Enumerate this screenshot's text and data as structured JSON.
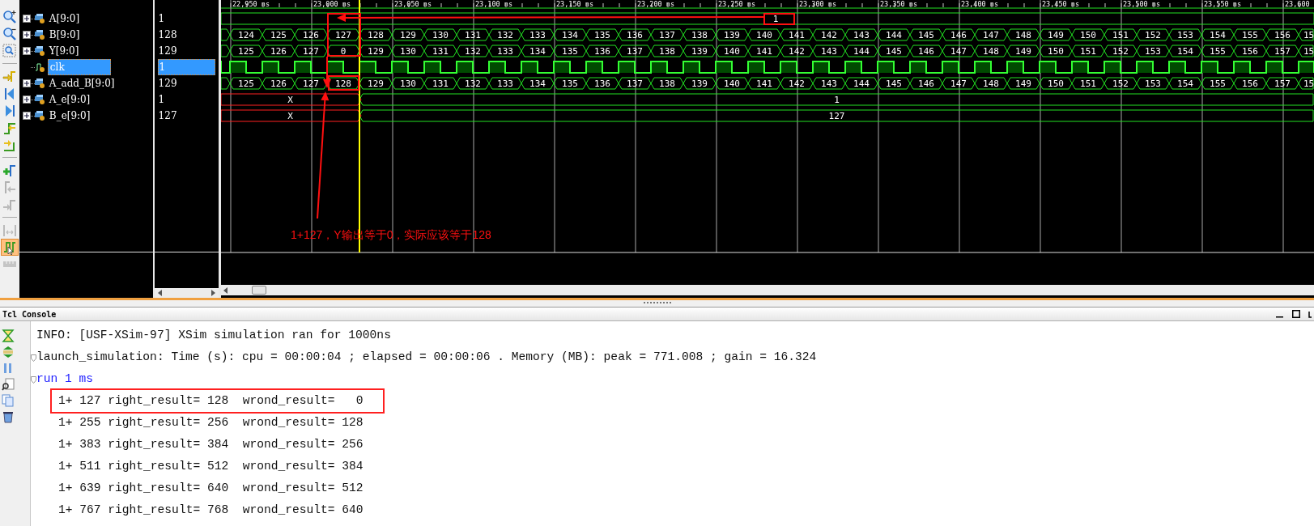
{
  "toolbar_groups": [
    {
      "tools": [
        {
          "kind": "zoom-in",
          "selected": false,
          "disabled": false
        },
        {
          "kind": "zoom-out",
          "selected": false,
          "disabled": false
        },
        {
          "kind": "zoom-fit",
          "selected": false,
          "disabled": false
        }
      ]
    },
    {
      "tools": [
        {
          "kind": "goto-cursor",
          "selected": false,
          "disabled": false
        },
        {
          "kind": "go-start",
          "selected": false,
          "disabled": false
        },
        {
          "kind": "go-end",
          "selected": false,
          "disabled": false
        },
        {
          "kind": "prev-transition",
          "selected": false,
          "disabled": false
        },
        {
          "kind": "next-transition",
          "selected": false,
          "disabled": false
        }
      ]
    },
    {
      "tools": [
        {
          "kind": "add-marker",
          "selected": false,
          "disabled": false
        },
        {
          "kind": "prev-marker",
          "selected": false,
          "disabled": true
        },
        {
          "kind": "next-marker",
          "selected": false,
          "disabled": true
        }
      ]
    },
    {
      "tools": [
        {
          "kind": "swap-cursors",
          "selected": false,
          "disabled": true
        },
        {
          "kind": "snap",
          "selected": true,
          "disabled": false
        },
        {
          "kind": "ruler",
          "selected": false,
          "disabled": true
        }
      ]
    }
  ],
  "time_ruler": {
    "labels": [
      "22,950 ns",
      "23,000 ns",
      "23,050 ns",
      "23,100 ns",
      "23,150 ns",
      "23,200 ns",
      "23,250 ns",
      "23,300 ns",
      "23,350 ns",
      "23,400 ns",
      "23,450 ns",
      "23,500 ns",
      "23,550 ns",
      "23,600"
    ]
  },
  "signals": [
    {
      "name": "A[9:0]",
      "value": "1",
      "expandable": true,
      "selected": false,
      "wave": {
        "kind": "const",
        "label": "1"
      }
    },
    {
      "name": "B[9:0]",
      "value": "128",
      "expandable": true,
      "selected": false,
      "wave": {
        "kind": "bus",
        "values": [
          "124",
          "125",
          "126",
          "127",
          "128",
          "129",
          "130",
          "131",
          "132",
          "133",
          "134",
          "135",
          "136",
          "137",
          "138",
          "139",
          "140",
          "141",
          "142",
          "143",
          "144",
          "145",
          "146",
          "147",
          "148",
          "149",
          "150",
          "151",
          "152",
          "153",
          "154",
          "155",
          "156",
          "15"
        ]
      }
    },
    {
      "name": "Y[9:0]",
      "value": "129",
      "expandable": true,
      "selected": false,
      "wave": {
        "kind": "bus",
        "values": [
          "125",
          "126",
          "127",
          "0",
          "129",
          "130",
          "131",
          "132",
          "133",
          "134",
          "135",
          "136",
          "137",
          "138",
          "139",
          "140",
          "141",
          "142",
          "143",
          "144",
          "145",
          "146",
          "147",
          "148",
          "149",
          "150",
          "151",
          "152",
          "153",
          "154",
          "155",
          "156",
          "157",
          "15"
        ]
      }
    },
    {
      "name": "clk",
      "value": "1",
      "expandable": false,
      "selected": true,
      "wave": {
        "kind": "clock"
      }
    },
    {
      "name": "A_add_B[9:0]",
      "value": "129",
      "expandable": true,
      "selected": false,
      "wave": {
        "kind": "bus",
        "values": [
          "125",
          "126",
          "127",
          "128",
          "129",
          "130",
          "131",
          "132",
          "133",
          "134",
          "135",
          "136",
          "137",
          "138",
          "139",
          "140",
          "141",
          "142",
          "143",
          "144",
          "145",
          "146",
          "147",
          "148",
          "149",
          "150",
          "151",
          "152",
          "153",
          "154",
          "155",
          "156",
          "157",
          "15"
        ]
      }
    },
    {
      "name": "A_e[9:0]",
      "value": "1",
      "expandable": true,
      "selected": false,
      "wave": {
        "kind": "unknown-then-const",
        "unknown_label": "X",
        "label": "1"
      }
    },
    {
      "name": "B_e[9:0]",
      "value": "127",
      "expandable": true,
      "selected": false,
      "wave": {
        "kind": "unknown-then-const",
        "unknown_label": "X",
        "label": "127"
      }
    }
  ],
  "annotation": {
    "note": "1+127，Y输出等于0，实际应该等于128"
  },
  "console": {
    "title": "Tcl Console",
    "lines": [
      {
        "kind": "plain",
        "text": "INFO: [USF-XSim-97] XSim simulation ran for 1000ns",
        "highlighted": false
      },
      {
        "kind": "fold",
        "text": "launch_simulation: Time (s): cpu = 00:00:04 ; elapsed = 00:00:06 . Memory (MB): peak = 771.008 ; gain = 16.324",
        "highlighted": false
      },
      {
        "kind": "command",
        "text": "run 1 ms",
        "highlighted": false
      },
      {
        "kind": "result",
        "text": "1+ 127 right_result= 128  wrond_result=   0",
        "highlighted": true
      },
      {
        "kind": "result",
        "text": "1+ 255 right_result= 256  wrond_result= 128",
        "highlighted": false
      },
      {
        "kind": "result",
        "text": "1+ 383 right_result= 384  wrond_result= 256",
        "highlighted": false
      },
      {
        "kind": "result",
        "text": "1+ 511 right_result= 512  wrond_result= 384",
        "highlighted": false
      },
      {
        "kind": "result",
        "text": "1+ 639 right_result= 640  wrond_result= 512",
        "highlighted": false
      },
      {
        "kind": "result",
        "text": "1+ 767 right_result= 768  wrond_result= 640",
        "highlighted": false
      }
    ]
  }
}
